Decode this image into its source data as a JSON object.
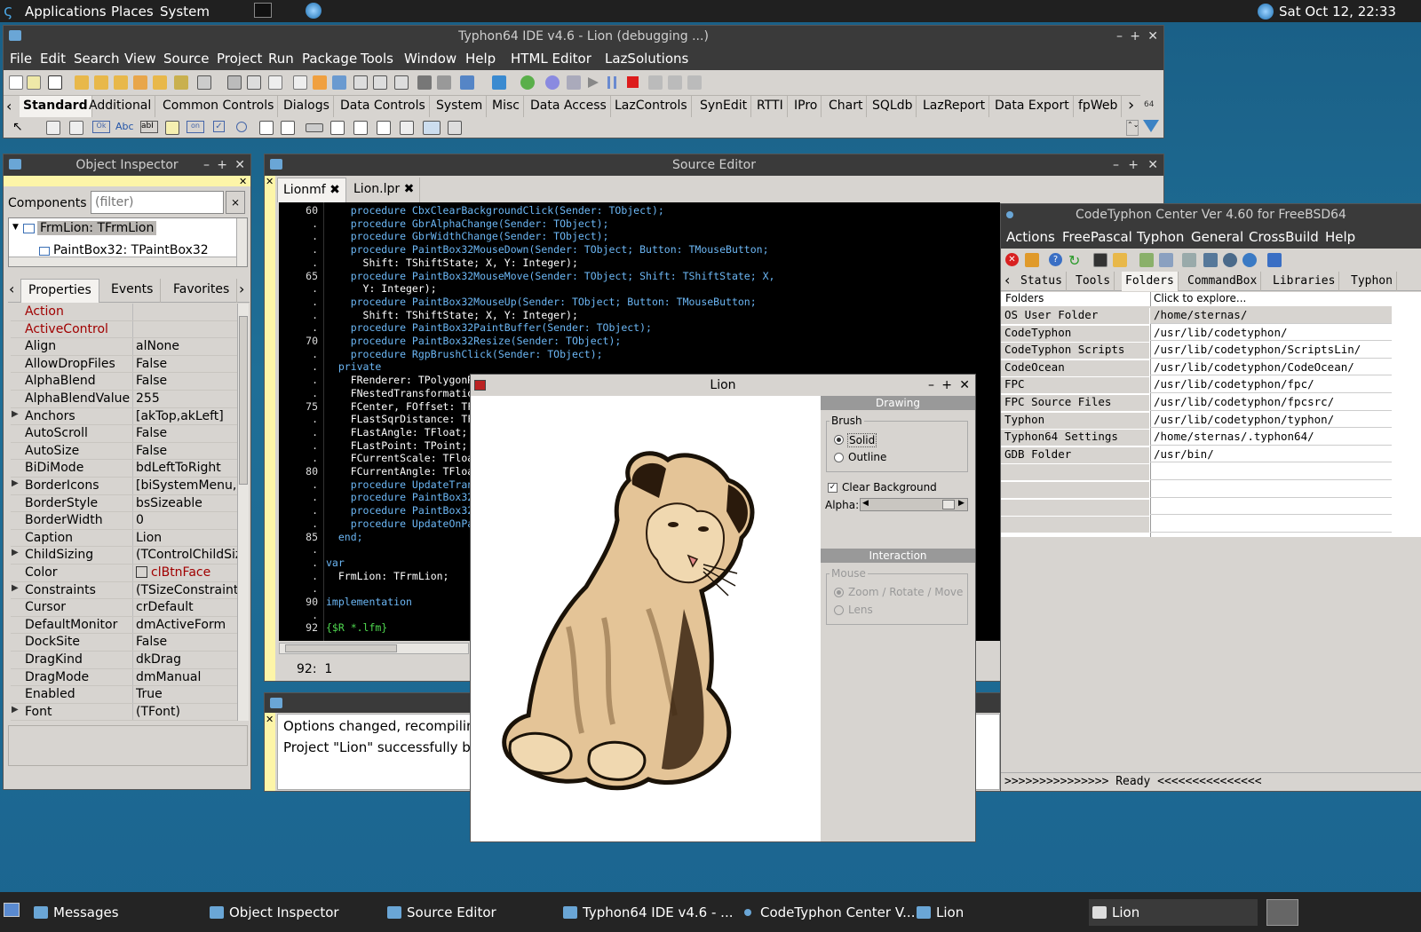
{
  "top_panel": {
    "menus": [
      "Applications",
      "Places",
      "System"
    ],
    "clock": "Sat Oct 12, 22:33"
  },
  "ide": {
    "title": "Typhon64 IDE v4.6 - Lion (debugging ...)",
    "menu": [
      "File",
      "Edit",
      "Search",
      "View",
      "Source",
      "Project",
      "Run",
      "Package",
      "Tools",
      "Window",
      "Help",
      "HTML Editor",
      "LazSolutions"
    ],
    "palette_tabs": [
      "Standard",
      "Additional",
      "Common Controls",
      "Dialogs",
      "Data Controls",
      "System",
      "Misc",
      "Data Access",
      "LazControls",
      "SynEdit",
      "RTTI",
      "IPro",
      "Chart",
      "SQLdb",
      "LazReport",
      "Data Export",
      "fpWeb"
    ],
    "palette_badge": "64"
  },
  "inspector": {
    "title": "Object Inspector",
    "components_label": "Components",
    "filter_placeholder": "(filter)",
    "tree": [
      "FrmLion: TFrmLion",
      "PaintBox32: TPaintBox32"
    ],
    "tabs": [
      "Properties",
      "Events",
      "Favorites"
    ],
    "props": [
      {
        "name": "Action",
        "value": "",
        "red": true,
        "exp": false
      },
      {
        "name": "ActiveControl",
        "value": "",
        "red": true,
        "exp": false
      },
      {
        "name": "Align",
        "value": "alNone",
        "exp": false
      },
      {
        "name": "AllowDropFiles",
        "value": "False",
        "exp": false
      },
      {
        "name": "AlphaBlend",
        "value": "False",
        "exp": false
      },
      {
        "name": "AlphaBlendValue",
        "value": "255",
        "exp": false
      },
      {
        "name": "Anchors",
        "value": "[akTop,akLeft]",
        "exp": true
      },
      {
        "name": "AutoScroll",
        "value": "False",
        "exp": false
      },
      {
        "name": "AutoSize",
        "value": "False",
        "exp": false
      },
      {
        "name": "BiDiMode",
        "value": "bdLeftToRight",
        "exp": false
      },
      {
        "name": "BorderIcons",
        "value": "[biSystemMenu,biMinimize,biMaximize]",
        "exp": true
      },
      {
        "name": "BorderStyle",
        "value": "bsSizeable",
        "exp": false
      },
      {
        "name": "BorderWidth",
        "value": "0",
        "exp": false
      },
      {
        "name": "Caption",
        "value": "Lion",
        "exp": false
      },
      {
        "name": "ChildSizing",
        "value": "(TControlChildSizing)",
        "exp": true
      },
      {
        "name": "Color",
        "value": "clBtnFace",
        "exp": false,
        "color": true
      },
      {
        "name": "Constraints",
        "value": "(TSizeConstraints)",
        "exp": true
      },
      {
        "name": "Cursor",
        "value": "crDefault",
        "exp": false
      },
      {
        "name": "DefaultMonitor",
        "value": "dmActiveForm",
        "exp": false
      },
      {
        "name": "DockSite",
        "value": "False",
        "exp": false
      },
      {
        "name": "DragKind",
        "value": "dkDrag",
        "exp": false
      },
      {
        "name": "DragMode",
        "value": "dmManual",
        "exp": false
      },
      {
        "name": "Enabled",
        "value": "True",
        "exp": false
      },
      {
        "name": "Font",
        "value": "(TFont)",
        "exp": true
      }
    ]
  },
  "source": {
    "title": "Source Editor",
    "tabs": [
      "Lionmf",
      "Lion.lpr"
    ],
    "status": "92:  1",
    "lines": [
      {
        "n": "60",
        "t": "    procedure CbxClearBackgroundClick(Sender: TObject);"
      },
      {
        "n": ".",
        "t": "    procedure GbrAlphaChange(Sender: TObject);"
      },
      {
        "n": ".",
        "t": "    procedure GbrWidthChange(Sender: TObject);"
      },
      {
        "n": ".",
        "t": "    procedure PaintBox32MouseDown(Sender: TObject; Button: TMouseButton;"
      },
      {
        "n": ".",
        "t": "      Shift: TShiftState; X, Y: Integer);"
      },
      {
        "n": "65",
        "t": "    procedure PaintBox32MouseMove(Sender: TObject; Shift: TShiftState; X,"
      },
      {
        "n": ".",
        "t": "      Y: Integer);"
      },
      {
        "n": ".",
        "t": "    procedure PaintBox32MouseUp(Sender: TObject; Button: TMouseButton;"
      },
      {
        "n": ".",
        "t": "      Shift: TShiftState; X, Y: Integer);"
      },
      {
        "n": ".",
        "t": "    procedure PaintBox32PaintBuffer(Sender: TObject);"
      },
      {
        "n": "70",
        "t": "    procedure PaintBox32Resize(Sender: TObject);"
      },
      {
        "n": ".",
        "t": "    procedure RgpBrushClick(Sender: TObject);"
      },
      {
        "n": ".",
        "t": "  private"
      },
      {
        "n": ".",
        "t": "    FRenderer: TPolygonR"
      },
      {
        "n": ".",
        "t": "    FNestedTransformatio"
      },
      {
        "n": "75",
        "t": "    FCenter, FOffset: TF"
      },
      {
        "n": ".",
        "t": "    FLastSqrDistance: TF"
      },
      {
        "n": ".",
        "t": "    FLastAngle: TFloat;"
      },
      {
        "n": ".",
        "t": "    FLastPoint: TPoint;"
      },
      {
        "n": ".",
        "t": "    FCurrentScale: TFloa"
      },
      {
        "n": "80",
        "t": "    FCurrentAngle: TFloa"
      },
      {
        "n": ".",
        "t": "    procedure UpdateTran"
      },
      {
        "n": ".",
        "t": "    procedure PaintBox32"
      },
      {
        "n": ".",
        "t": "    procedure PaintBox32"
      },
      {
        "n": ".",
        "t": "    procedure UpdateOnPa"
      },
      {
        "n": "85",
        "t": "  end;"
      },
      {
        "n": ".",
        "t": ""
      },
      {
        "n": ".",
        "t": "var"
      },
      {
        "n": ".",
        "t": "  FrmLion: TFrmLion;"
      },
      {
        "n": ".",
        "t": ""
      },
      {
        "n": "90",
        "t": "implementation"
      },
      {
        "n": ".",
        "t": ""
      },
      {
        "n": "92",
        "t": "{$R *.lfm}"
      }
    ]
  },
  "messages": {
    "lines": [
      "Options changed, recompiling",
      "Project \"Lion\" successfully bui"
    ]
  },
  "center": {
    "title": "CodeTyphon Center Ver 4.60 for FreeBSD64",
    "menu": [
      "Actions",
      "FreePascal",
      "Typhon",
      "General",
      "CrossBuild",
      "Help"
    ],
    "tabs": [
      "Status",
      "Tools",
      "Folders",
      "CommandBox",
      "Libraries",
      "Typhon"
    ],
    "header": [
      "Folders",
      "Click to explore..."
    ],
    "folders": [
      {
        "k": "OS User Folder",
        "v": "/home/sternas/"
      },
      {
        "k": "CodeTyphon",
        "v": "/usr/lib/codetyphon/"
      },
      {
        "k": "CodeTyphon Scripts",
        "v": "/usr/lib/codetyphon/ScriptsLin/"
      },
      {
        "k": "CodeOcean",
        "v": "/usr/lib/codetyphon/CodeOcean/"
      },
      {
        "k": "FPC",
        "v": "/usr/lib/codetyphon/fpc/"
      },
      {
        "k": "FPC Source Files",
        "v": "/usr/lib/codetyphon/fpcsrc/"
      },
      {
        "k": "Typhon",
        "v": "/usr/lib/codetyphon/typhon/"
      },
      {
        "k": "Typhon64 Settings",
        "v": "/home/sternas/.typhon64/"
      },
      {
        "k": "GDB Folder",
        "v": "/usr/bin/"
      }
    ],
    "status": ">>>>>>>>>>>>>>> Ready <<<<<<<<<<<<<<<"
  },
  "lion": {
    "title": "Lion",
    "drawing_header": "Drawing",
    "brush_label": "Brush",
    "solid": "Solid",
    "outline": "Outline",
    "clear_bg": "Clear Background",
    "alpha_label": "Alpha:",
    "interaction_header": "Interaction",
    "mouse_label": "Mouse",
    "zoom": "Zoom / Rotate / Move",
    "lens": "Lens"
  },
  "taskbar": [
    "Messages",
    "Object Inspector",
    "Source Editor",
    "Typhon64 IDE v4.6 - ...",
    "CodeTyphon Center V...",
    "Lion",
    "Lion"
  ]
}
